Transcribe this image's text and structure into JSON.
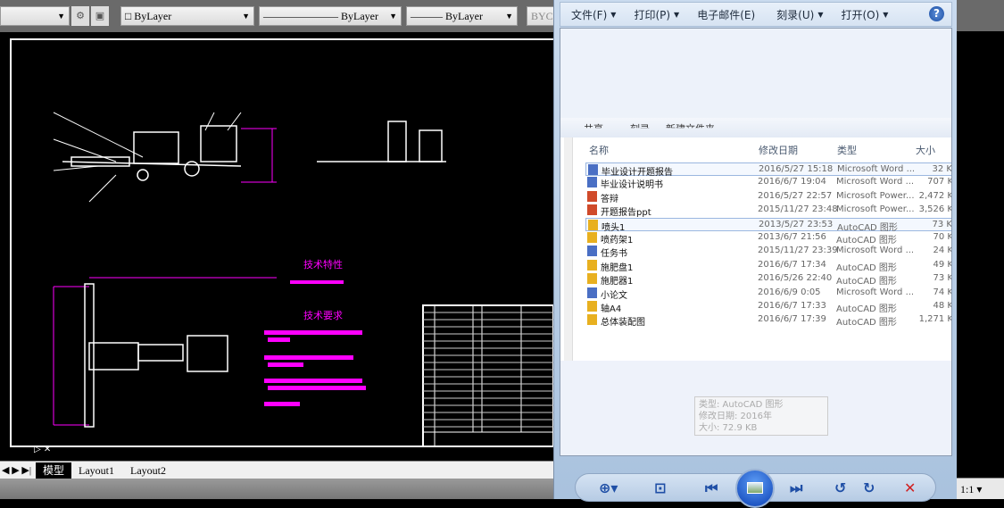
{
  "cad": {
    "toolbar": {
      "color": "ByLayer",
      "linetype": "ByLayer",
      "lineweight": "ByLayer",
      "plotstyle": "BYCO"
    },
    "drawing": {
      "heading_characteristics": "技术特性",
      "heading_requirements": "技术要求",
      "line_color": "#ff00ff"
    },
    "tabs": [
      "模型",
      "Layout1",
      "Layout2"
    ],
    "scale": "1:1"
  },
  "viewer": {
    "menu": [
      {
        "label": "文件(F)",
        "dropdown": true
      },
      {
        "label": "打印(P)",
        "dropdown": true
      },
      {
        "label": "电子邮件(E)",
        "dropdown": false
      },
      {
        "label": "刻录(U)",
        "dropdown": true
      },
      {
        "label": "打开(O)",
        "dropdown": true
      }
    ],
    "explorer": {
      "commands": [
        "共享",
        "刻录",
        "新建文件夹"
      ],
      "columns": [
        "名称",
        "修改日期",
        "类型",
        "大小"
      ],
      "files": [
        {
          "name": "毕业设计开题报告",
          "date": "2016/5/27 15:18",
          "type": "Microsoft Word ...",
          "size": "32 K",
          "icon": "word"
        },
        {
          "name": "毕业设计说明书",
          "date": "2016/6/7 19:04",
          "type": "Microsoft Word ...",
          "size": "707 K",
          "icon": "word"
        },
        {
          "name": "答辩",
          "date": "2016/5/27 22:57",
          "type": "Microsoft Power...",
          "size": "2,472 K",
          "icon": "ppt"
        },
        {
          "name": "开题报告ppt",
          "date": "2015/11/27 23:48",
          "type": "Microsoft Power...",
          "size": "3,526 K",
          "icon": "ppt"
        },
        {
          "name": "喷头1",
          "date": "2013/5/27 23:53",
          "type": "AutoCAD 图形",
          "size": "73 K",
          "icon": "dwg"
        },
        {
          "name": "喷药架1",
          "date": "2013/6/7 21:56",
          "type": "AutoCAD 图形",
          "size": "70 K",
          "icon": "dwg"
        },
        {
          "name": "任务书",
          "date": "2015/11/27 23:39",
          "type": "Microsoft Word ...",
          "size": "24 K",
          "icon": "word"
        },
        {
          "name": "施肥盘1",
          "date": "2016/6/7 17:34",
          "type": "AutoCAD 图形",
          "size": "49 K",
          "icon": "dwg"
        },
        {
          "name": "施肥器1",
          "date": "2016/5/26 22:40",
          "type": "AutoCAD 图形",
          "size": "73 K",
          "icon": "dwg"
        },
        {
          "name": "小论文",
          "date": "2016/6/9 0:05",
          "type": "Microsoft Word ...",
          "size": "74 K",
          "icon": "word"
        },
        {
          "name": "轴A4",
          "date": "2016/6/7 17:33",
          "type": "AutoCAD 图形",
          "size": "48 K",
          "icon": "dwg"
        },
        {
          "name": "总体装配图",
          "date": "2016/6/7 17:39",
          "type": "AutoCAD 图形",
          "size": "1,271 K",
          "icon": "dwg"
        }
      ],
      "tooltip": [
        "类型: AutoCAD 图形",
        "修改日期: 2016年",
        "大小: 72.9 KB"
      ]
    }
  }
}
